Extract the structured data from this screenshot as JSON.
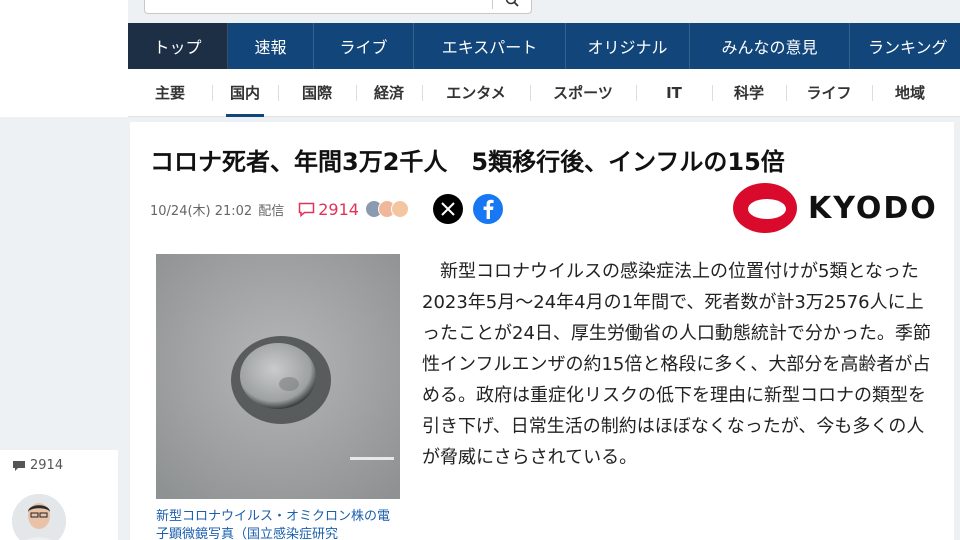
{
  "search": {
    "icon": "search-icon"
  },
  "main_nav": {
    "items": [
      {
        "label": "トップ",
        "active": true
      },
      {
        "label": "速報"
      },
      {
        "label": "ライブ"
      },
      {
        "label": "エキスパート"
      },
      {
        "label": "オリジナル"
      },
      {
        "label": "みんなの意見"
      },
      {
        "label": "ランキング"
      }
    ],
    "bg_color": "#12467a"
  },
  "sub_nav": {
    "items": [
      {
        "label": "主要"
      },
      {
        "label": "国内",
        "active": true
      },
      {
        "label": "国際"
      },
      {
        "label": "経済"
      },
      {
        "label": "エンタメ"
      },
      {
        "label": "スポーツ"
      },
      {
        "label": "IT"
      },
      {
        "label": "科学"
      },
      {
        "label": "ライフ"
      },
      {
        "label": "地域"
      }
    ]
  },
  "article": {
    "headline": "コロナ死者、年間3万2千人　5類移行後、インフルの15倍",
    "date": "10/24(木) 21:02",
    "source_label": "配信",
    "comment_count": "2914",
    "comment_color": "#e0325a",
    "publisher": "KYODO",
    "photo_caption": "新型コロナウイルス・オミクロン株の電子顕微鏡写真（国立感染症研究",
    "body": "　新型コロナウイルスの感染症法上の位置付けが5類となった2023年5月～24年4月の1年間で、死者数が計3万2576人に上ったことが24日、厚生労働省の人口動態統計で分かった。季節性インフルエンザの約15倍と格段に多く、大部分を高齢者が占める。政府は重症化リスクの低下を理由に新型コロナの類型を引き下げ、日常生活の制約はほぼなくなったが、今も多くの人が脅威にさらされている。"
  },
  "side_widget": {
    "comment_count": "2914"
  }
}
